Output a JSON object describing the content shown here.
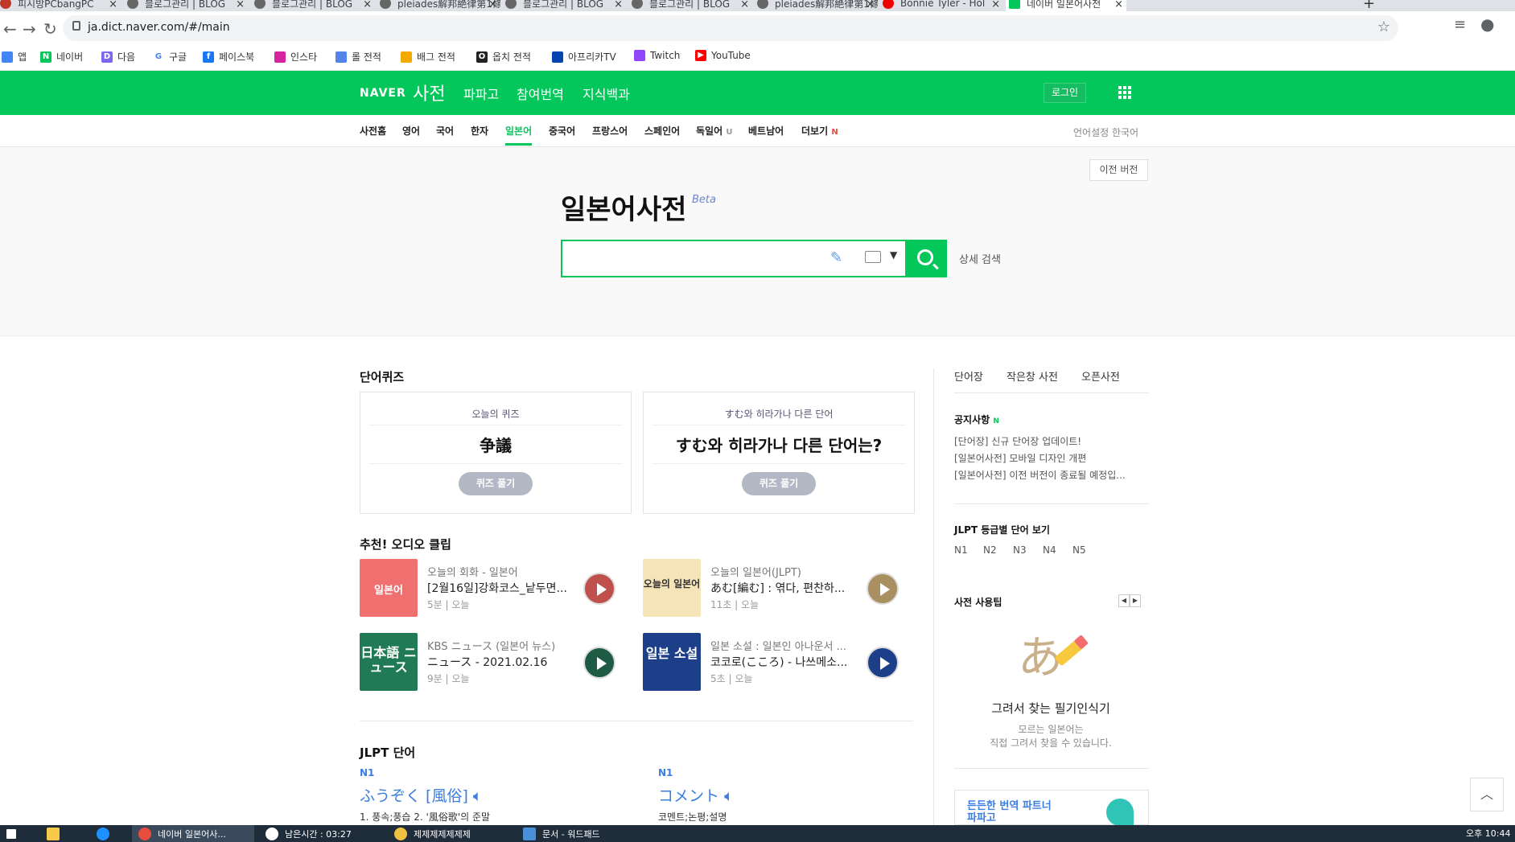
{
  "browser": {
    "tabs": [
      {
        "title": "피시방PCbangPC"
      },
      {
        "title": "블로그관리 | BLOG"
      },
      {
        "title": "블로그관리 | BLOG"
      },
      {
        "title": "pleiades解邦絶律第1條"
      },
      {
        "title": "블로그관리 | BLOG"
      },
      {
        "title": "블로그관리 | BLOG"
      },
      {
        "title": "pleiades解邦絶律第1條"
      },
      {
        "title": "Bonnie Tyler - Hol"
      },
      {
        "title": "네이버 일본어사전"
      }
    ],
    "url": "ja.dict.naver.com/#/main",
    "bookmarks": [
      "앱",
      "네이버",
      "다음",
      "구글",
      "페이스북",
      "인스타",
      "롤 전적",
      "배그 전적",
      "옵치 전적",
      "아프리카TV",
      "Twitch",
      "YouTube"
    ]
  },
  "gnb": {
    "logo": "NAVER",
    "service": "사전",
    "menu": [
      "파파고",
      "참여번역",
      "지식백과"
    ],
    "login": "로그인"
  },
  "lnb": {
    "items": [
      "사전홈",
      "영어",
      "국어",
      "한자",
      "일본어",
      "중국어",
      "프랑스어",
      "스페인어",
      "독일어",
      "베트남어",
      "더보기"
    ],
    "new_badge": "N",
    "u_badge": "U",
    "lang_setting": "언어설정 한국어"
  },
  "hero": {
    "prev_version": "이전 버전",
    "title": "일본어사전",
    "beta": "Beta",
    "search_placeholder": "",
    "detail_search": "상세 검색"
  },
  "quiz": {
    "section": "단어퀴즈",
    "cards": [
      {
        "label": "오늘의 퀴즈",
        "question": "争議",
        "button": "퀴즈 풀기"
      },
      {
        "label": "すむ와 히라가나 다른 단어",
        "question": "すむ와 히라가나 다른 단어는?",
        "button": "퀴즈 풀기"
      }
    ]
  },
  "audio": {
    "section": "추천! 오디오 클립",
    "clips": [
      {
        "category": "오늘의 회화 - 일본어",
        "title": "[2월16일]강화코스_낱두면...",
        "duration": "5분",
        "date": "오늘",
        "thumb_text": "일본어"
      },
      {
        "category": "오늘의 일본어(JLPT)",
        "title": "あむ[編む] : 엮다, 편찬하...",
        "duration": "11초",
        "date": "오늘",
        "thumb_text": "오늘의 일본어"
      },
      {
        "category": "KBS ニュース (일본어 뉴스)",
        "title": "ニュース - 2021.02.16",
        "duration": "9분",
        "date": "오늘",
        "thumb_text": "日本語 ニュース"
      },
      {
        "category": "일본 소설 : 일본인 아나운서 ...",
        "title": "코코로(こころ) - 나쓰메소...",
        "duration": "5초",
        "date": "오늘",
        "thumb_text": "일본 소설"
      }
    ]
  },
  "jlpt": {
    "section": "JLPT 단어",
    "words": [
      {
        "level": "N1",
        "word": "ふうぞく [風俗]",
        "meaning": "1. 풍속;풍습 2. '風俗歌'의 준말"
      },
      {
        "level": "N1",
        "word": "コメント",
        "meaning": "코멘트;논평;설명"
      }
    ]
  },
  "sidebar": {
    "tabs": [
      "단어장",
      "작은창 사전",
      "오픈사전"
    ],
    "notice_title": "공지사항",
    "notice_badge": "N",
    "notices": [
      "[단어장] 신규 단어장 업데이트!",
      "[일본어사전] 모바일 디자인 개편",
      "[일본어사전] 이전 버전이 종료될 예정입..."
    ],
    "jlpt_title": "JLPT 등급별 단어 보기",
    "levels": [
      "N1",
      "N2",
      "N3",
      "N4",
      "N5"
    ],
    "tips_title": "사전 사용팁",
    "tip_heading": "그려서 찾는 필기인식기",
    "tip_line1": "모르는 일본어는",
    "tip_line2": "직접 그려서 찾을 수 있습니다.",
    "promo_line1": "든든한 번역 파트너",
    "promo_line2": "파파고"
  },
  "taskbar": {
    "items": [
      "네이버 일본어사...",
      "남은시간 : 03:27",
      "제제제제제제제",
      "문서 - 워드패드"
    ],
    "time": "오후 10:44"
  },
  "colors": {
    "naver_green": "#03c75a",
    "link_blue": "#3b7de0"
  }
}
